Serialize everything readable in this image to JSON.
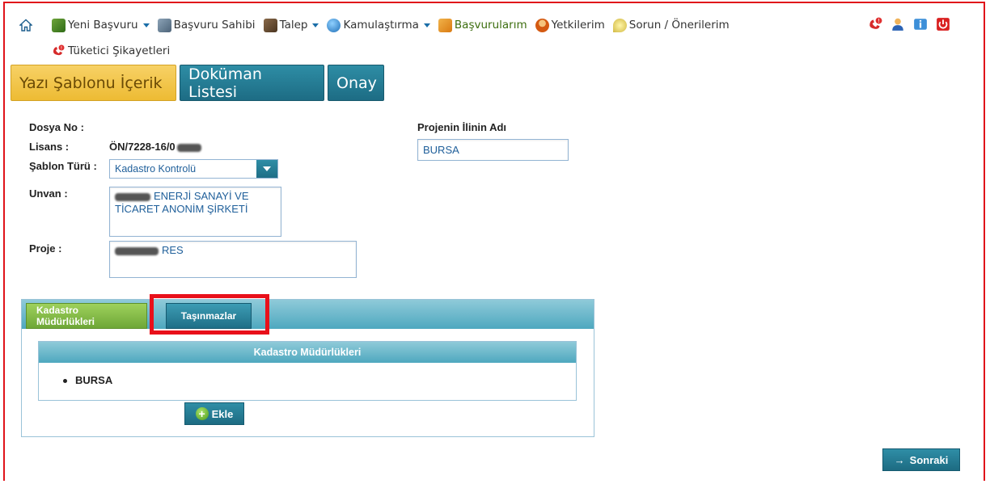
{
  "menu": {
    "row1": [
      {
        "label": "Yeni Başvuru",
        "icon": "new-application-icon",
        "dropdown": true
      },
      {
        "label": "Başvuru Sahibi",
        "icon": "applicant-icon",
        "dropdown": false
      },
      {
        "label": "Talep",
        "icon": "request-icon",
        "dropdown": true
      },
      {
        "label": "Kamulaştırma",
        "icon": "globe-icon",
        "dropdown": true
      },
      {
        "label": "Başvurularım",
        "icon": "folder-icon",
        "dropdown": false,
        "active": true
      },
      {
        "label": "Yetkilerim",
        "icon": "users-icon",
        "dropdown": false
      },
      {
        "label": "Sorun / Önerilerim",
        "icon": "speech-bubble-icon",
        "dropdown": false
      }
    ],
    "row2": [
      {
        "label": "Tüketici Şikayetleri",
        "icon": "phone-alert-icon"
      }
    ]
  },
  "step_tabs": [
    {
      "label": "Yazı Şablonu İçerik",
      "active": true
    },
    {
      "label": "Doküman Listesi",
      "active": false
    },
    {
      "label": "Onay",
      "active": false
    }
  ],
  "form": {
    "dosya_no_label": "Dosya No :",
    "dosya_no_value": "",
    "lisans_label": "Lisans :",
    "lisans_value": "ÖN/7228-16/0",
    "sablon_label": "Şablon Türü :",
    "sablon_value": "Kadastro Kontrolü",
    "unvan_label": "Unvan :",
    "unvan_value_line1": "ENERJİ SANAYİ VE",
    "unvan_value_line2": "TİCARET ANONİM ŞİRKETİ",
    "proje_label": "Proje :",
    "proje_value": "RES",
    "proje_il_label": "Projenin İlinin Adı",
    "proje_il_value": "BURSA"
  },
  "panel": {
    "tabs": [
      "Kadastro Müdürlükleri",
      "Taşınmazlar"
    ],
    "table_header": "Kadastro Müdürlükleri",
    "items": [
      "BURSA"
    ],
    "add_button": "Ekle"
  },
  "next_button": "Sonraki",
  "colors": {
    "accent": "#1d6c84",
    "active_tab": "#edbb33",
    "highlight": "#e8101a",
    "green_tab": "#6ea737"
  }
}
